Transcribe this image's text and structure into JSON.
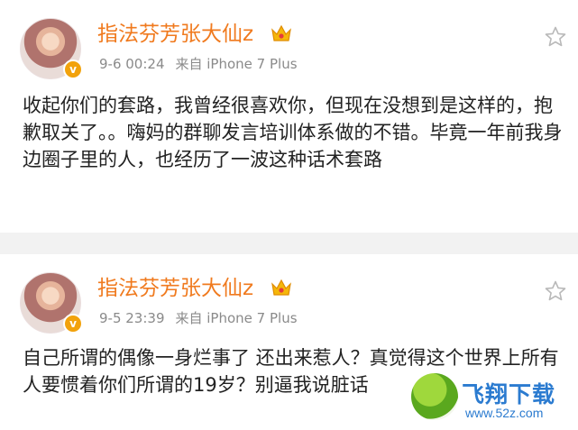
{
  "posts": [
    {
      "username": "指法芬芳张大仙z",
      "time": "9-6 00:24",
      "source": "来自 iPhone 7 Plus",
      "badge": "v",
      "text": "收起你们的套路，我曾经很喜欢你，但现在没想到是这样的，抱歉取关了。。嗨妈的群聊发言培训体系做的不错。毕竟一年前我身边圈子里的人，也经历了一波这种话术套路"
    },
    {
      "username": "指法芬芳张大仙z",
      "time": "9-5 23:39",
      "source": "来自 iPhone 7 Plus",
      "badge": "v",
      "text": "自己所谓的偶像一身烂事了 还出来惹人？真觉得这个世界上所有人要惯着你们所谓的19岁？别逼我说脏话"
    }
  ],
  "watermark": {
    "title": "飞翔下载",
    "url": "www.52z.com"
  },
  "colors": {
    "username": "#f07a1e",
    "meta": "#8a8a8a",
    "badge": "#f2a20c",
    "divider": "#f2f2f2",
    "watermark": "#2b7bd0"
  }
}
